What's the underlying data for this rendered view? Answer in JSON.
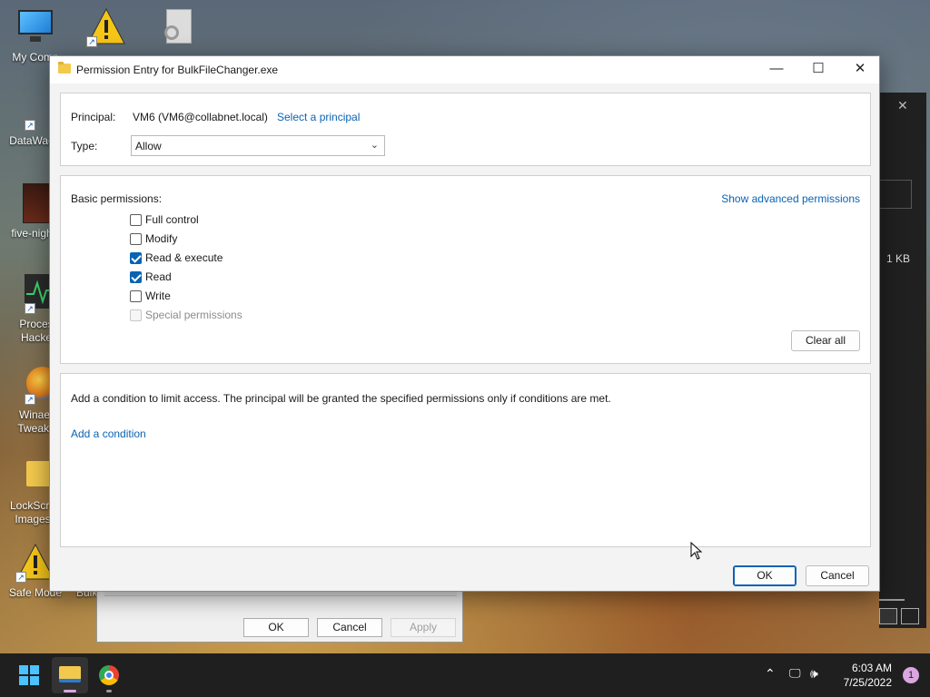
{
  "desktop": {
    "icons": [
      {
        "label": "My Comp"
      },
      {
        "label": "DataWag"
      },
      {
        "label": "five-nigh"
      },
      {
        "label": "Proces Hacke"
      },
      {
        "label": "Winaer Tweake"
      },
      {
        "label": "LockScre Images"
      },
      {
        "label": "Safe Mode"
      },
      {
        "label": "Bulk"
      }
    ]
  },
  "background_dialog": {
    "ok": "OK",
    "cancel": "Cancel",
    "apply": "Apply"
  },
  "dark_window": {
    "close": "✕",
    "size": "1 KB"
  },
  "dialog": {
    "title": "Permission Entry for BulkFileChanger.exe",
    "controls": {
      "minimize": "—",
      "maximize": "☐",
      "close": "✕"
    },
    "principal_label": "Principal:",
    "principal_value": "VM6 (VM6@collabnet.local)",
    "select_principal": "Select a principal",
    "type_label": "Type:",
    "type_value": "Allow",
    "basic_permissions_label": "Basic permissions:",
    "show_advanced": "Show advanced permissions",
    "permissions": [
      {
        "label": "Full control",
        "checked": false,
        "disabled": false
      },
      {
        "label": "Modify",
        "checked": false,
        "disabled": false
      },
      {
        "label": "Read & execute",
        "checked": true,
        "disabled": false
      },
      {
        "label": "Read",
        "checked": true,
        "disabled": false
      },
      {
        "label": "Write",
        "checked": false,
        "disabled": false
      },
      {
        "label": "Special permissions",
        "checked": false,
        "disabled": true
      }
    ],
    "clear_all": "Clear all",
    "condition_text": "Add a condition to limit access. The principal will be granted the specified permissions only if conditions are met.",
    "add_condition": "Add a condition",
    "ok": "OK",
    "cancel": "Cancel"
  },
  "taskbar": {
    "time": "6:03 AM",
    "date": "7/25/2022",
    "notification_count": "1"
  },
  "colors": {
    "accent": "#0a63b3",
    "taskbar": "#1f1f1f"
  }
}
